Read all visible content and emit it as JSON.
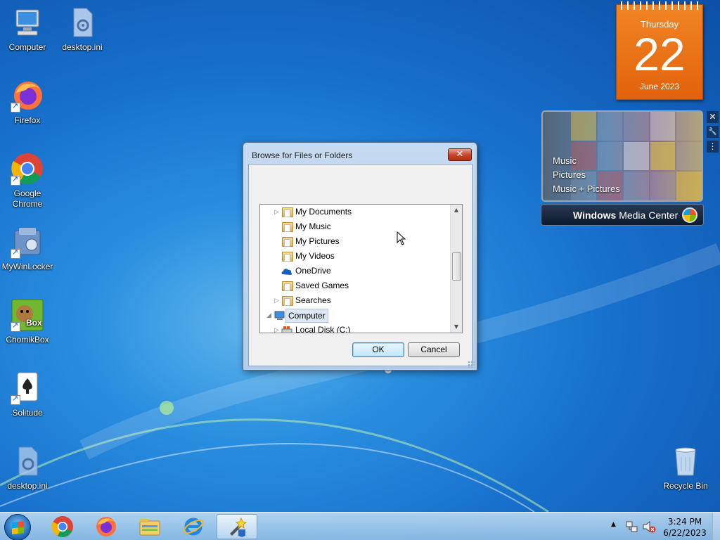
{
  "desktop": {
    "icons": [
      {
        "label": "Computer",
        "icon": "computer-icon"
      },
      {
        "label": "desktop.ini",
        "icon": "settings-file-icon"
      },
      {
        "label": "Firefox",
        "icon": "firefox-icon"
      },
      {
        "label": "Google Chrome",
        "icon": "chrome-icon"
      },
      {
        "label": "MyWinLocker",
        "icon": "mywinlocker-icon"
      },
      {
        "label": "ChomikBox",
        "icon": "chomikbox-icon",
        "badge": "Box"
      },
      {
        "label": "Solitude",
        "icon": "solitaire-icon"
      },
      {
        "label": "desktop.ini",
        "icon": "settings-file-icon"
      },
      {
        "label": "Recycle Bin",
        "icon": "recycle-bin-icon"
      }
    ]
  },
  "calendar": {
    "weekday": "Thursday",
    "day": "22",
    "month_year": "June 2023"
  },
  "media_center": {
    "menu": [
      "Music",
      "Pictures",
      "Music + Pictures"
    ],
    "bar_label_bold": "Windows",
    "bar_label_rest": " Media Center"
  },
  "gadget_controls": {
    "close": "✕",
    "options": "🔧",
    "drag": "⋮"
  },
  "dialog": {
    "title": "Browse for Files or Folders",
    "close_glyph": "✕",
    "tree": [
      {
        "label": "My Documents",
        "expandable": true,
        "level": 2
      },
      {
        "label": "My Music",
        "expandable": false,
        "level": 2
      },
      {
        "label": "My Pictures",
        "expandable": false,
        "level": 2
      },
      {
        "label": "My Videos",
        "expandable": false,
        "level": 2
      },
      {
        "label": "OneDrive",
        "expandable": false,
        "level": 2,
        "icon": "onedrive-icon"
      },
      {
        "label": "Saved Games",
        "expandable": false,
        "level": 2
      },
      {
        "label": "Searches",
        "expandable": true,
        "level": 2
      },
      {
        "label": "Computer",
        "expandable": true,
        "expanded": true,
        "level": 1,
        "selected": true,
        "icon": "computer-icon"
      },
      {
        "label": "Local Disk (C:)",
        "expandable": true,
        "level": 2,
        "icon": "drive-icon"
      }
    ],
    "ok_label": "OK",
    "cancel_label": "Cancel"
  },
  "taskbar": {
    "pinned": [
      "chrome-icon",
      "firefox-icon",
      "explorer-icon",
      "internet-explorer-icon",
      "installer-wizard-icon"
    ],
    "clock_time": "3:24 PM",
    "clock_date": "6/22/2023",
    "tray_chevron": "▲"
  }
}
